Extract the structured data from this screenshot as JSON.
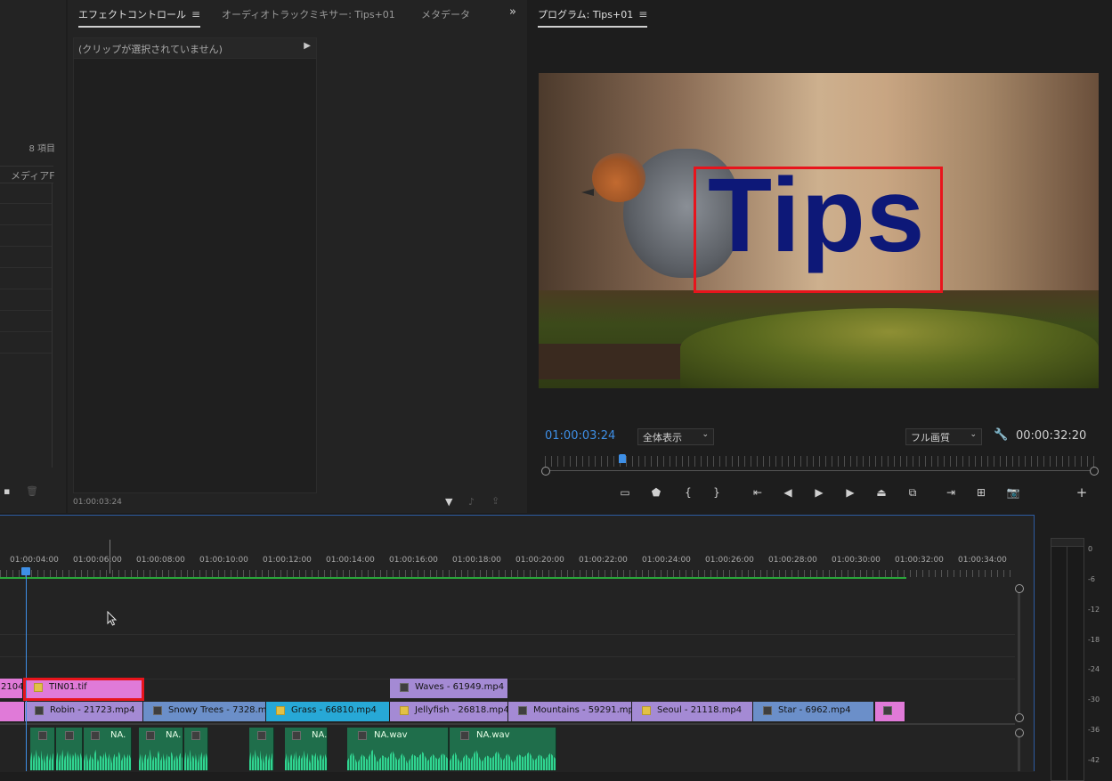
{
  "project": {
    "item_count": "8 項目",
    "column_media": "メディアF"
  },
  "effects_panel": {
    "tabs": [
      {
        "label": "エフェクトコントロール"
      },
      {
        "label": "オーディオトラックミキサー: Tips+01"
      },
      {
        "label": "メタデータ"
      }
    ],
    "no_clip_selected": "(クリップが選択されていません)",
    "timecode": "01:00:03:24"
  },
  "program_monitor": {
    "title": "プログラム: Tips+01",
    "overlay_text": "Tips",
    "current_timecode": "01:00:03:24",
    "zoom_select": "全体表示",
    "quality_select": "フル画質",
    "duration": "00:00:32:20",
    "playhead_fraction": 0.14
  },
  "timeline": {
    "ruler_labels": [
      "01:00:04:00",
      "01:00:06:00",
      "01:00:08:00",
      "01:00:10:00",
      "01:00:12:00",
      "01:00:14:00",
      "01:00:16:00",
      "01:00:18:00",
      "01:00:20:00",
      "01:00:22:00",
      "01:00:24:00",
      "01:00:26:00",
      "01:00:28:00",
      "01:00:30:00",
      "01:00:32:00",
      "01:00:34:00"
    ],
    "v3_clips": [
      {
        "name": "2104"
      },
      {
        "name": "TIN01.tif"
      },
      {
        "name": "Waves - 61949.mp4"
      }
    ],
    "v2_clips": [
      {
        "name": "Robin - 21723.mp4"
      },
      {
        "name": "Snowy Trees - 7328.mp"
      },
      {
        "name": "Grass - 66810.mp4"
      },
      {
        "name": "Jellyfish - 26818.mp4"
      },
      {
        "name": "Mountains - 59291.mp4"
      },
      {
        "name": "Seoul - 21118.mp4"
      },
      {
        "name": "Star - 6962.mp4"
      }
    ],
    "audio_clips": [
      {
        "name": "NA."
      },
      {
        "name": "NA."
      },
      {
        "name": "NA."
      },
      {
        "name": "NA.wav"
      },
      {
        "name": "NA.wav"
      }
    ]
  },
  "meter": {
    "labels": [
      "0",
      "-6",
      "-12",
      "-18",
      "-24",
      "-30",
      "-36",
      "-42"
    ]
  },
  "colors": {
    "accent_blue": "#3e8fe6",
    "highlight_red": "#e8141c",
    "tips_text": "#0d1878"
  }
}
